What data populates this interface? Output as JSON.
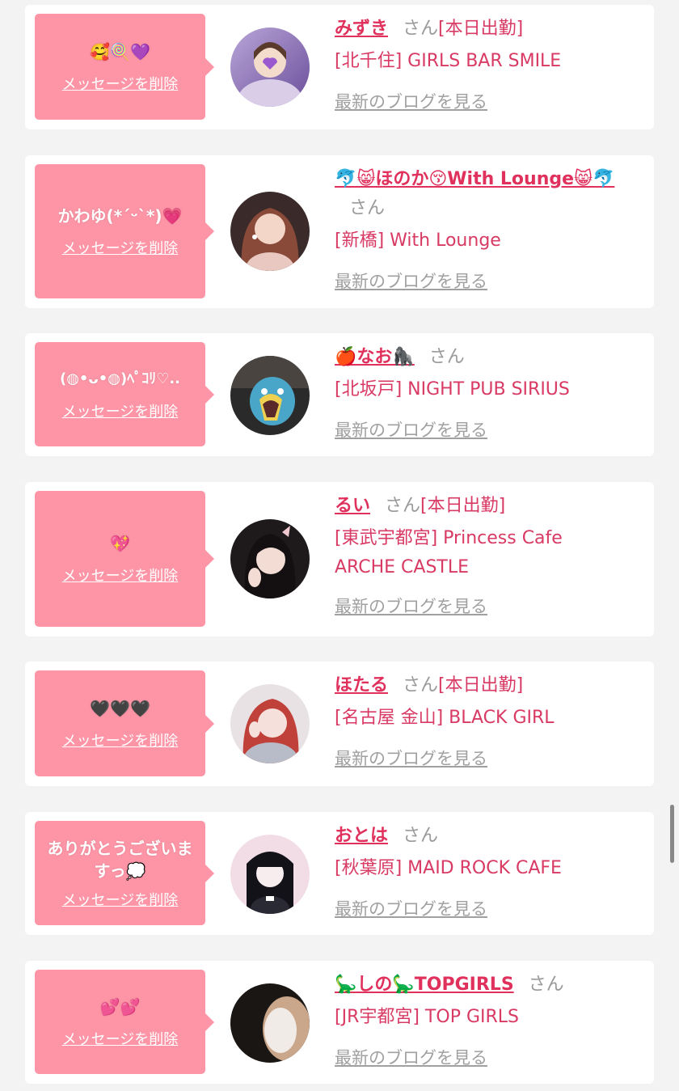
{
  "san_label": "さん",
  "delete_label": "メッセージを削除",
  "blog_label": "最新のブログを見る",
  "today_label": "[本日出勤]",
  "colors": {
    "bubble": "#fd95a6",
    "name": "#e0305c",
    "shop": "#d83a64",
    "muted": "#a0a0a0"
  },
  "items": [
    {
      "message": "🥰🍭💜",
      "name": "みずき",
      "shop": "[北千住] GIRLS BAR SMILE",
      "today": true
    },
    {
      "message": "かわゆ(*ˊᵕˋ*)💗",
      "name": "🐬😸ほのか😚With Lounge😸🐬",
      "shop": "[新橋] With Lounge",
      "today": false
    },
    {
      "message": "(◍•ᴗ•◍)ﾍﾟｺﾘ♡..",
      "name": "🍎なお🦍",
      "shop": "[北坂戸] NIGHT PUB SIRIUS",
      "today": false
    },
    {
      "message": "💖",
      "name": "るい",
      "shop": "[東武宇都宮] Princess Cafe ARCHE CASTLE",
      "today": true
    },
    {
      "message": "🖤🖤🖤",
      "name": "ほたる",
      "shop": "[名古屋 金山] BLACK GIRL",
      "today": true
    },
    {
      "message": "ありがとうございますっ💭",
      "name": "おとは",
      "shop": "[秋葉原] MAID ROCK CAFE",
      "today": false
    },
    {
      "message": "💕💕",
      "name": "🦕しの🦕TOPGIRLS",
      "shop": "[JR宇都宮] TOP GIRLS",
      "today": false
    }
  ]
}
